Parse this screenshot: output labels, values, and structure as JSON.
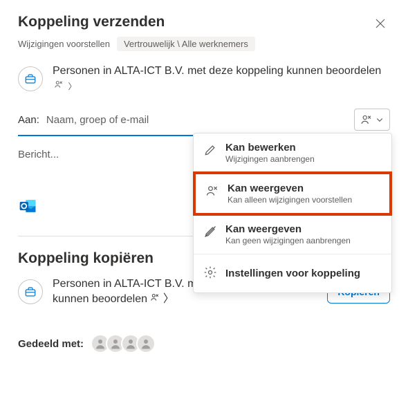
{
  "header": {
    "title": "Koppeling verzenden",
    "subtitle": "Wijzigingen voorstellen",
    "badge": "Vertrouwelijk \\ Alle werknemers"
  },
  "info": {
    "text": "Personen in ALTA-ICT B.V. met deze koppeling kunnen beoordelen"
  },
  "recipients": {
    "label": "Aan:",
    "placeholder": "Naam, groep of e-mail"
  },
  "message": {
    "placeholder": "Bericht..."
  },
  "dropdown": {
    "items": [
      {
        "title": "Kan bewerken",
        "sub": "Wijzigingen aanbrengen"
      },
      {
        "title": "Kan weergeven",
        "sub": "Kan alleen wijzigingen voorstellen"
      },
      {
        "title": "Kan weergeven",
        "sub": "Kan geen wijzigingen aanbrengen"
      }
    ],
    "settings": "Instellingen voor koppeling"
  },
  "copy": {
    "title": "Koppeling kopiëren",
    "text": "Personen in ALTA-ICT B.V. met deze koppeling kunnen beoordelen",
    "button": "Kopiëren"
  },
  "shared": {
    "label": "Gedeeld met:"
  }
}
